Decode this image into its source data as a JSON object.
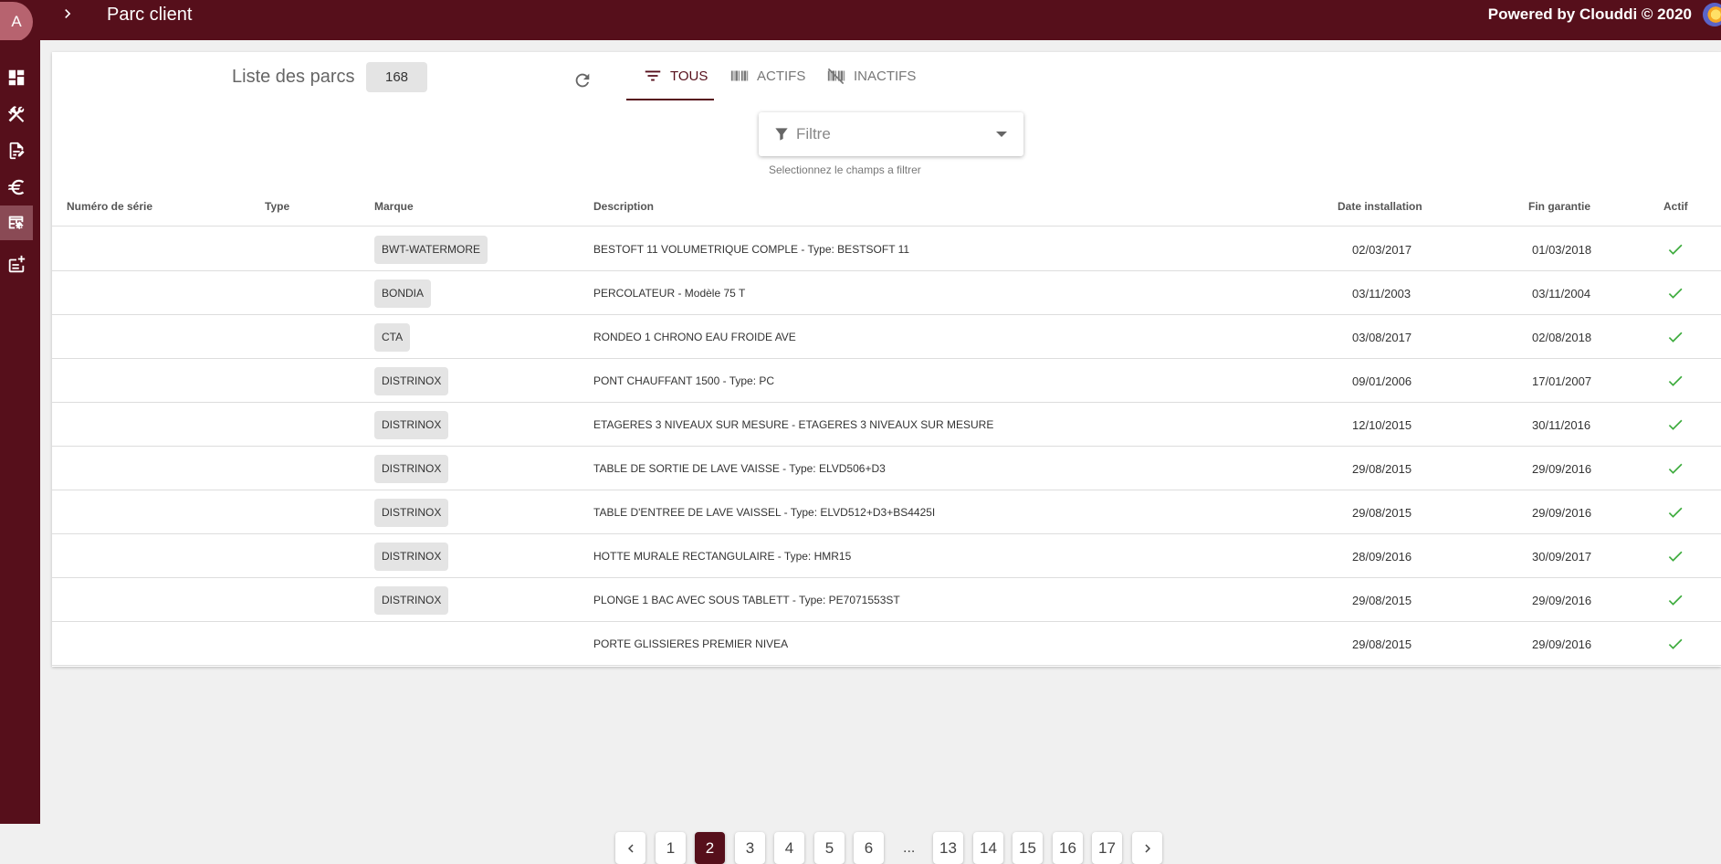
{
  "header": {
    "avatar_initial": "A",
    "title": "Parc client",
    "powered_by": "Powered by Clouddi © 2020"
  },
  "sidebar": {
    "items": [
      {
        "icon": "dashboard-icon"
      },
      {
        "icon": "tools-icon"
      },
      {
        "icon": "edit-document-icon"
      },
      {
        "icon": "euro-icon"
      },
      {
        "icon": "table-settings-icon",
        "active": true
      },
      {
        "icon": "add-to-list-icon"
      }
    ],
    "logout_icon": "logout-icon"
  },
  "list": {
    "title": "Liste des parcs",
    "count": "168"
  },
  "tabs": [
    {
      "label": "TOUS",
      "icon": "filter-list-icon",
      "active": true
    },
    {
      "label": "ACTIFS",
      "icon": "barcode-icon",
      "active": false
    },
    {
      "label": "INACTIFS",
      "icon": "barcode-off-icon",
      "active": false
    }
  ],
  "filter": {
    "placeholder": "Filtre",
    "hint": "Selectionnez le champs a filtrer"
  },
  "table": {
    "columns": {
      "serial": "Numéro de série",
      "type": "Type",
      "brand": "Marque",
      "description": "Description",
      "install_date": "Date installation",
      "warranty_end": "Fin garantie",
      "active": "Actif"
    },
    "rows": [
      {
        "serial": "",
        "type": "",
        "brand": "BWT-WATERMORE",
        "description": "BESTOFT 11 VOLUMETRIQUE COMPLE - Type: BESTSOFT 11",
        "install_date": "02/03/2017",
        "warranty_end": "01/03/2018",
        "active": true
      },
      {
        "serial": "",
        "type": "",
        "brand": "BONDIA",
        "description": "PERCOLATEUR - Modèle 75 T",
        "install_date": "03/11/2003",
        "warranty_end": "03/11/2004",
        "active": true
      },
      {
        "serial": "",
        "type": "",
        "brand": "CTA",
        "description": "RONDEO 1 CHRONO EAU FROIDE AVE",
        "install_date": "03/08/2017",
        "warranty_end": "02/08/2018",
        "active": true
      },
      {
        "serial": "",
        "type": "",
        "brand": "DISTRINOX",
        "description": "PONT CHAUFFANT 1500 - Type: PC",
        "install_date": "09/01/2006",
        "warranty_end": "17/01/2007",
        "active": true
      },
      {
        "serial": "",
        "type": "",
        "brand": "DISTRINOX",
        "description": "ETAGERES 3 NIVEAUX SUR MESURE - ETAGERES 3 NIVEAUX SUR MESURE",
        "install_date": "12/10/2015",
        "warranty_end": "30/11/2016",
        "active": true
      },
      {
        "serial": "",
        "type": "",
        "brand": "DISTRINOX",
        "description": "TABLE DE SORTIE DE LAVE VAISSE - Type: ELVD506+D3",
        "install_date": "29/08/2015",
        "warranty_end": "29/09/2016",
        "active": true
      },
      {
        "serial": "",
        "type": "",
        "brand": "DISTRINOX",
        "description": "TABLE D'ENTREE DE LAVE VAISSEL - Type: ELVD512+D3+BS4425I",
        "install_date": "29/08/2015",
        "warranty_end": "29/09/2016",
        "active": true
      },
      {
        "serial": "",
        "type": "",
        "brand": "DISTRINOX",
        "description": "HOTTE MURALE RECTANGULAIRE - Type: HMR15",
        "install_date": "28/09/2016",
        "warranty_end": "30/09/2017",
        "active": true
      },
      {
        "serial": "",
        "type": "",
        "brand": "DISTRINOX",
        "description": "PLONGE 1 BAC AVEC SOUS TABLETT - Type: PE7071553ST",
        "install_date": "29/08/2015",
        "warranty_end": "29/09/2016",
        "active": true
      },
      {
        "serial": "",
        "type": "",
        "brand": "",
        "description": "PORTE GLISSIERES PREMIER NIVEA",
        "install_date": "29/08/2015",
        "warranty_end": "29/09/2016",
        "active": true
      }
    ]
  },
  "pagination": {
    "pages_before": [
      "1",
      "2",
      "3",
      "4",
      "5",
      "6"
    ],
    "ellipsis": "...",
    "pages_after": [
      "13",
      "14",
      "15",
      "16",
      "17"
    ],
    "current": "2"
  },
  "colors": {
    "primary": "#560f1b",
    "avatar": "#b7636f",
    "check": "#3cab3c"
  }
}
